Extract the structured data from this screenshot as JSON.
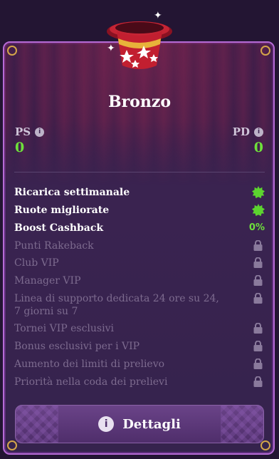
{
  "tier": {
    "name": "Bronzo",
    "ps_label": "PS",
    "ps_value": "0",
    "pd_label": "PD",
    "pd_value": "0"
  },
  "features": [
    {
      "label": "Ricarica settimanale",
      "status": "active",
      "indicator": "check-badge-icon"
    },
    {
      "label": "Ruote migliorate",
      "status": "active",
      "indicator": "check-badge-icon"
    },
    {
      "label": "Boost Cashback",
      "status": "active",
      "indicator": "percent",
      "value": "0%"
    },
    {
      "label": "Punti Rakeback",
      "status": "locked",
      "indicator": "lock-icon"
    },
    {
      "label": "Club VIP",
      "status": "locked",
      "indicator": "lock-icon"
    },
    {
      "label": "Manager VIP",
      "status": "locked",
      "indicator": "lock-icon"
    },
    {
      "label": "Linea di supporto dedicata 24 ore su 24, 7 giorni su 7",
      "status": "locked",
      "indicator": "lock-icon"
    },
    {
      "label": "Tornei VIP esclusivi",
      "status": "locked",
      "indicator": "lock-icon"
    },
    {
      "label": "Bonus esclusivi per i VIP",
      "status": "locked",
      "indicator": "lock-icon"
    },
    {
      "label": "Aumento dei limiti di prelievo",
      "status": "locked",
      "indicator": "lock-icon"
    },
    {
      "label": "Priorità nella coda dei prelievi",
      "status": "locked",
      "indicator": "lock-icon"
    }
  ],
  "details_button": {
    "label": "Dettagli",
    "icon": "info-icon"
  },
  "colors": {
    "accent_green": "#6ee03b",
    "card_border": "#b66bd6",
    "background": "#231533"
  }
}
